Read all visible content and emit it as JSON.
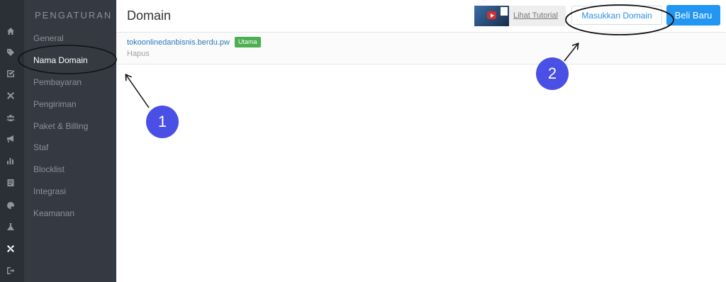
{
  "rail": {
    "icons": [
      "home-icon",
      "tag-icon",
      "check-square-icon",
      "tools-icon",
      "users-icon",
      "megaphone-icon",
      "bar-chart-icon",
      "document-icon",
      "palette-icon",
      "flask-icon",
      "wrench-icon",
      "logout-icon"
    ]
  },
  "submenu": {
    "title": "PENGATURAN",
    "items": [
      "General",
      "Nama Domain",
      "Pembayaran",
      "Pengiriman",
      "Paket & Billing",
      "Staf",
      "Blocklist",
      "Integrasi",
      "Keamanan"
    ],
    "active": "Nama Domain"
  },
  "header": {
    "title": "Domain",
    "tutorial_label": "Lihat Tutorial",
    "enter_domain_label": "Masukkan Domain",
    "buy_new_label": "Beli Baru"
  },
  "domains": [
    {
      "name": "tokoonlinedanbisnis.berdu.pw",
      "badge": "Utama",
      "delete_label": "Hapus"
    }
  ],
  "annotations": {
    "marker_1": "1",
    "marker_2": "2"
  },
  "colors": {
    "rail_bg": "#2b2f36",
    "submenu_bg": "#353a42",
    "primary_blue": "#2196f3",
    "badge_green": "#4caf50",
    "marker_fill": "#4a4fe6"
  }
}
